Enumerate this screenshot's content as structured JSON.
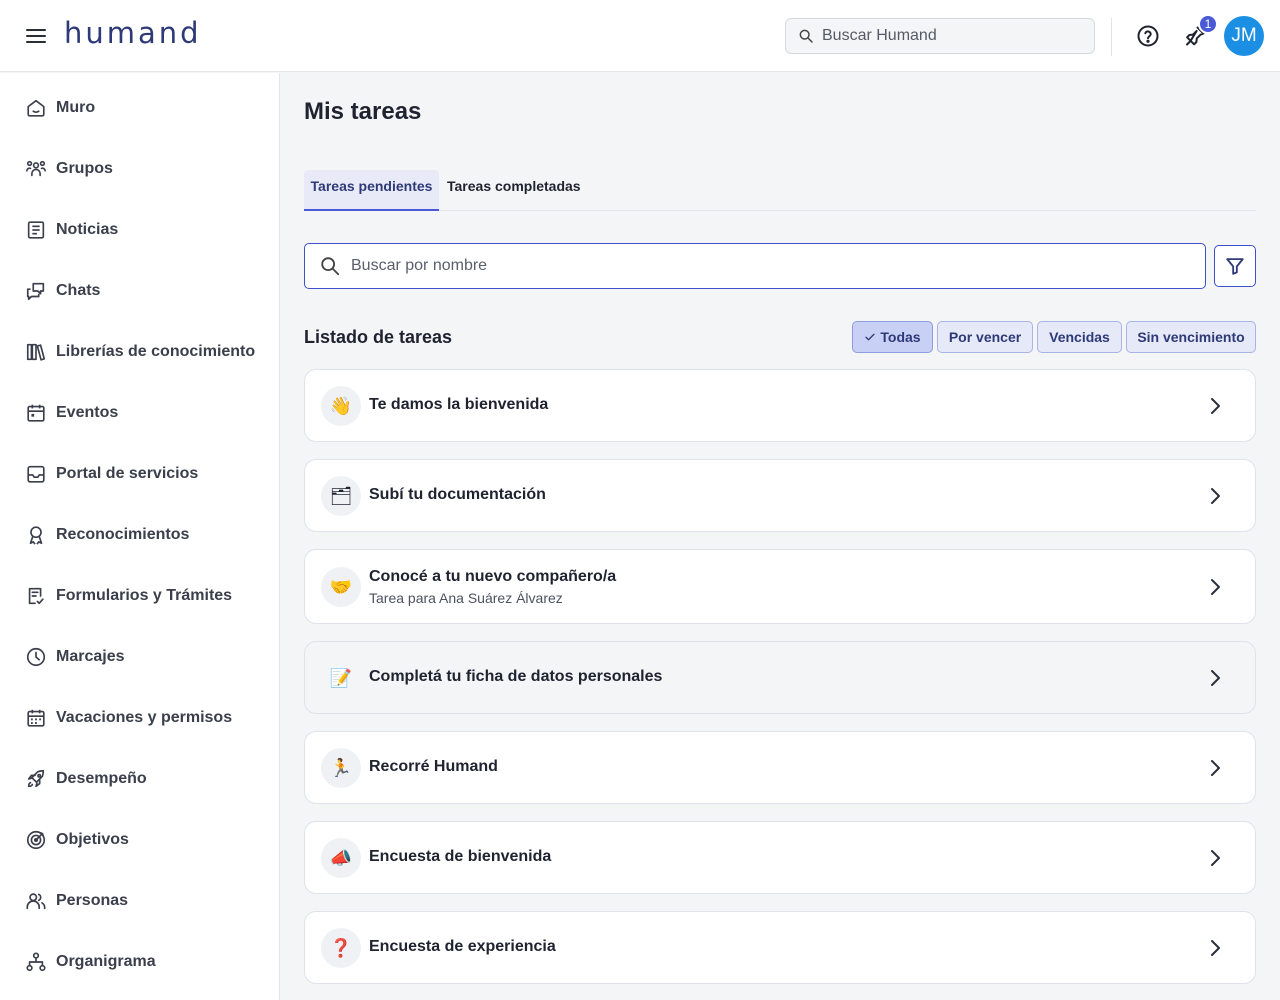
{
  "header": {
    "logo_text": "humand",
    "search_placeholder": "Buscar Humand",
    "notification_count": "1",
    "avatar_initials": "JM"
  },
  "sidebar": {
    "items": [
      {
        "label": "Muro",
        "icon": "home-icon"
      },
      {
        "label": "Grupos",
        "icon": "groups-icon"
      },
      {
        "label": "Noticias",
        "icon": "news-icon"
      },
      {
        "label": "Chats",
        "icon": "chat-icon"
      },
      {
        "label": "Librerías de conocimiento",
        "icon": "library-icon"
      },
      {
        "label": "Eventos",
        "icon": "calendar-icon"
      },
      {
        "label": "Portal de servicios",
        "icon": "inbox-icon"
      },
      {
        "label": "Reconocimientos",
        "icon": "award-icon"
      },
      {
        "label": "Formularios y Trámites",
        "icon": "form-check-icon"
      },
      {
        "label": "Marcajes",
        "icon": "clock-icon"
      },
      {
        "label": "Vacaciones y permisos",
        "icon": "calendar-days-icon"
      },
      {
        "label": "Desempeño",
        "icon": "rocket-icon"
      },
      {
        "label": "Objetivos",
        "icon": "target-icon"
      },
      {
        "label": "Personas",
        "icon": "people-icon"
      },
      {
        "label": "Organigrama",
        "icon": "org-chart-icon"
      }
    ]
  },
  "main": {
    "title": "Mis tareas",
    "tabs": [
      {
        "label": "Tareas pendientes",
        "active": true
      },
      {
        "label": "Tareas completadas",
        "active": false
      }
    ],
    "search_placeholder": "Buscar por nombre",
    "list_title": "Listado de tareas",
    "filters": [
      {
        "label": "Todas",
        "selected": true
      },
      {
        "label": "Por vencer",
        "selected": false
      },
      {
        "label": "Vencidas",
        "selected": false
      },
      {
        "label": "Sin vencimiento",
        "selected": false
      }
    ],
    "tasks": [
      {
        "title": "Te damos la bienvenida",
        "subtitle": "",
        "emoji": "👋",
        "emoji_name": "waving-hand-icon"
      },
      {
        "title": "Subí tu documentación",
        "subtitle": "",
        "emoji": "🗂",
        "emoji_name": "folder-icon"
      },
      {
        "title": "Conocé a tu nuevo compañero/a",
        "subtitle": "Tarea para Ana Suárez Álvarez",
        "emoji": "🤝",
        "emoji_name": "handshake-icon"
      },
      {
        "title": "Completá tu ficha de datos personales",
        "subtitle": "",
        "emoji": "📝",
        "emoji_name": "memo-icon"
      },
      {
        "title": "Recorré Humand",
        "subtitle": "",
        "emoji": "🏃",
        "emoji_name": "runner-icon"
      },
      {
        "title": "Encuesta de bienvenida",
        "subtitle": "",
        "emoji": "📣",
        "emoji_name": "megaphone-icon"
      },
      {
        "title": "Encuesta de experiencia",
        "subtitle": "",
        "emoji": "❓",
        "emoji_name": "question-mark-icon"
      }
    ]
  },
  "colors": {
    "brand": "#2e3a78",
    "accent": "#4a5ad7",
    "avatar": "#1a8fe3"
  }
}
